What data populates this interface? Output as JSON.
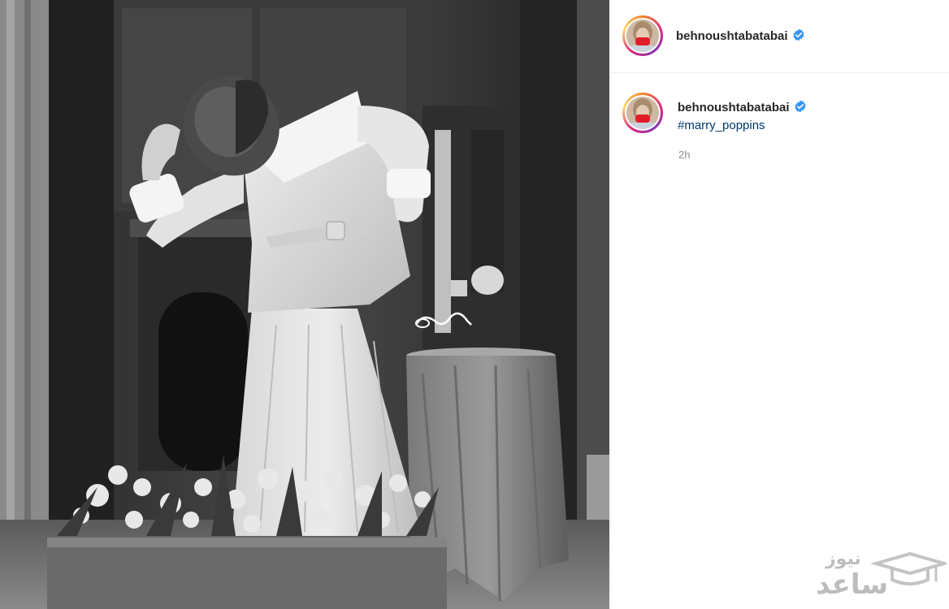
{
  "post": {
    "username": "behnoushtabatabai",
    "verified": true
  },
  "caption": {
    "username": "behnoushtabatabai",
    "hashtag": "#marry_poppins",
    "timestamp": "2h"
  },
  "watermark": {
    "line1": "نیوز",
    "line2": "ساعد"
  },
  "colors": {
    "verified_badge": "#3897f0",
    "hashtag_link": "#00376b",
    "timestamp": "#8e8e8e"
  }
}
